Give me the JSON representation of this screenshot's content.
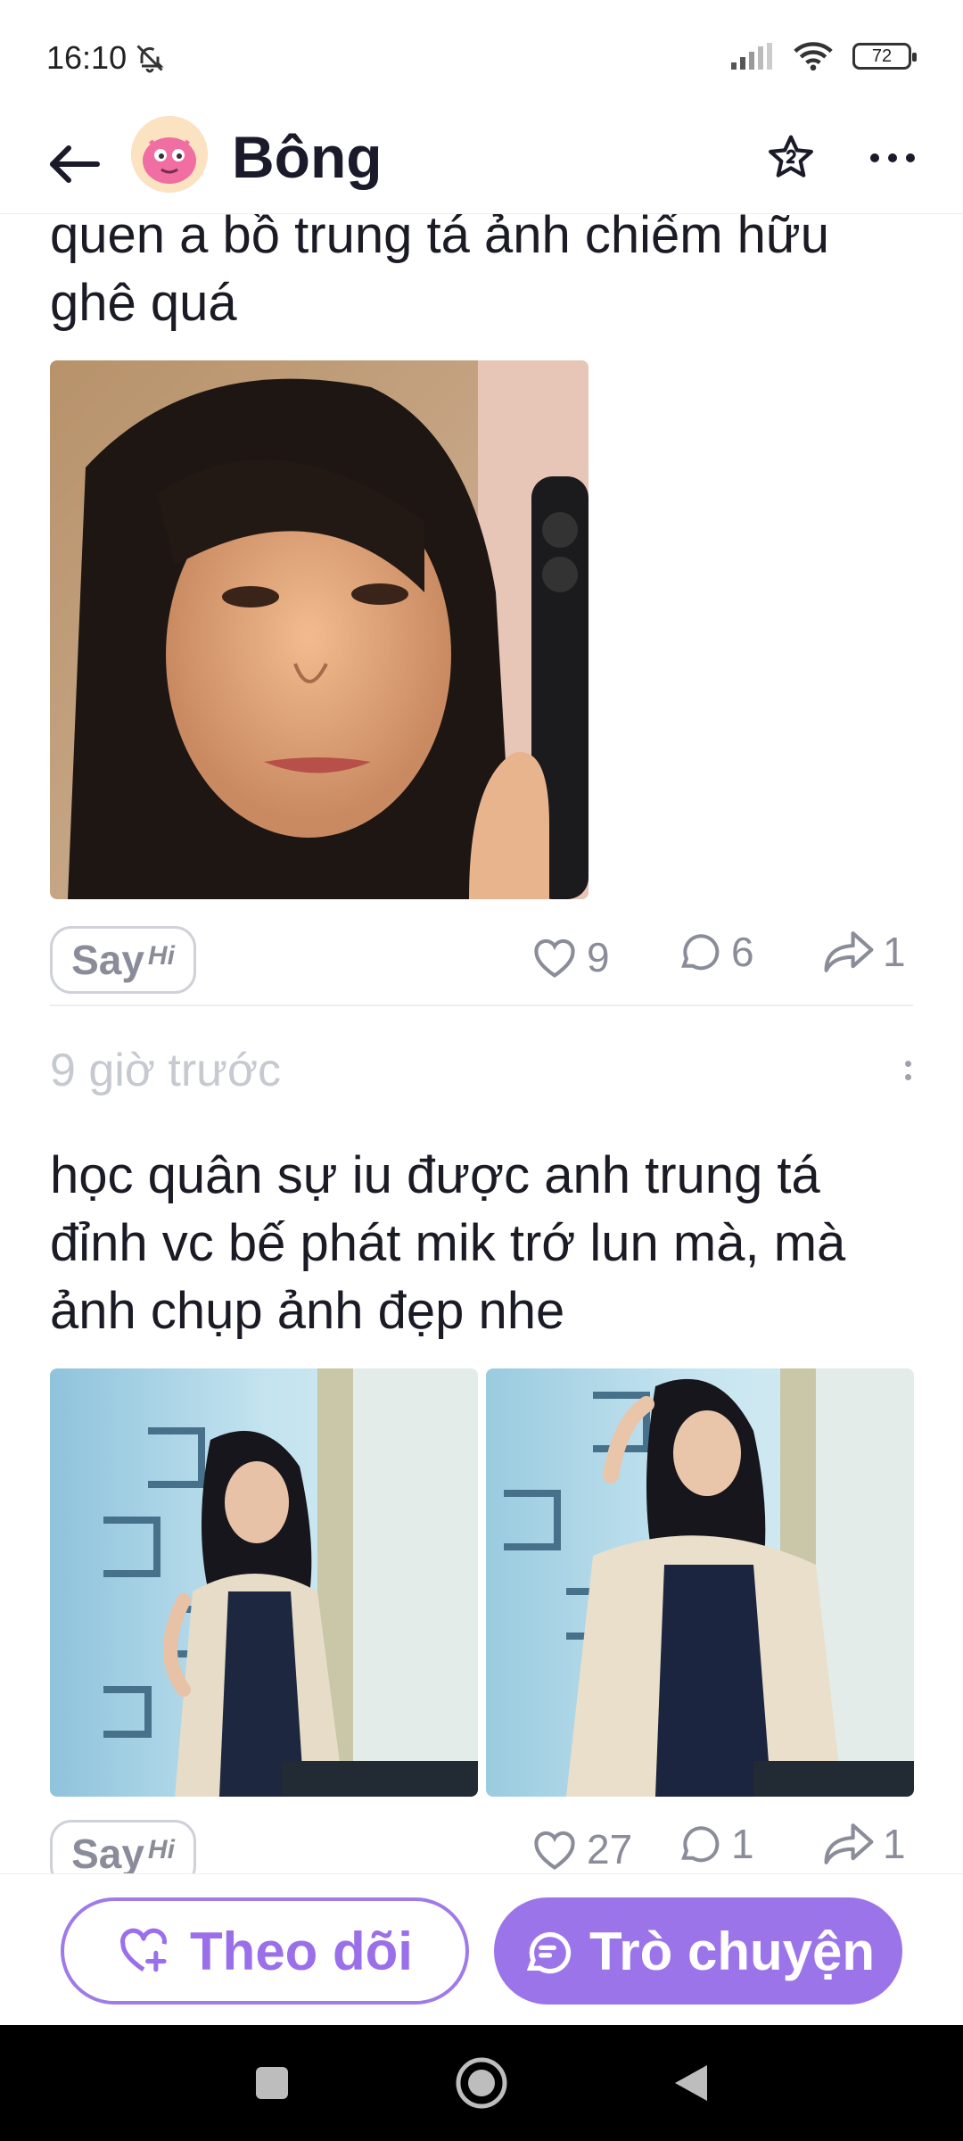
{
  "status_bar": {
    "time": "16:10",
    "battery": "72"
  },
  "header": {
    "name": "Bông"
  },
  "posts": [
    {
      "text": "quen a bồ trung tá ảnh chiếm hữu ghê quá",
      "likes": "9",
      "comments": "6",
      "shares": "1"
    },
    {
      "timestamp": "9 giờ trước",
      "text": "học quân sự iu được anh trung tá đỉnh vc bế phát mik trớ lun mà, mà ảnh chụp ảnh đẹp nhe",
      "likes": "27",
      "comments": "1",
      "shares": "1"
    }
  ],
  "sayhi": {
    "say": "Say",
    "hi": "Hi"
  },
  "bottom": {
    "follow_label": "Theo dõi",
    "chat_label": "Trò chuyện"
  },
  "colors": {
    "accent": "#9c74ea",
    "muted": "#8a8d99"
  }
}
